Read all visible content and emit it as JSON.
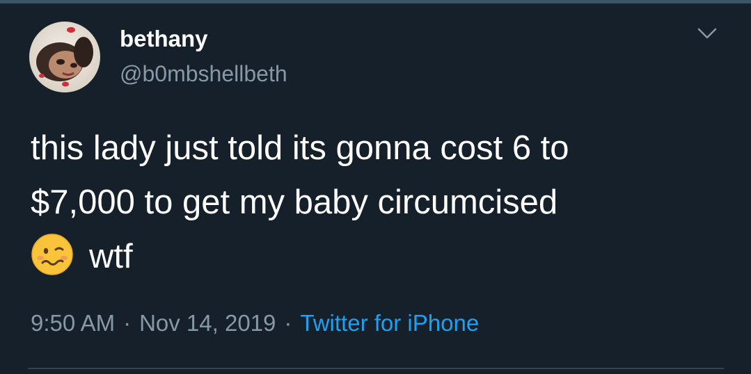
{
  "tweet": {
    "author": {
      "display_name": "bethany",
      "handle": "@b0mbshellbeth"
    },
    "text_lines": [
      "this lady just told its gonna cost 6 to",
      "$7,000 to get my baby circumcised"
    ],
    "text_tail": "wtf",
    "emoji": "woozy-face-emoji",
    "time": "9:50 AM",
    "date": "Nov 14, 2019",
    "separator": "·",
    "source": "Twitter for iPhone"
  },
  "icons": {
    "menu": "chevron-down-icon"
  },
  "colors": {
    "background": "#15202b",
    "text": "#ffffff",
    "muted": "#8899a6",
    "link": "#1da1f2",
    "divider": "#38444d"
  }
}
